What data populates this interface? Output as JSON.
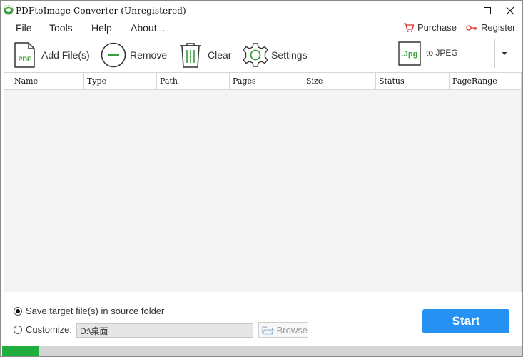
{
  "window": {
    "title": "PDFtoImage Converter (Unregistered)",
    "controls": [
      "minimize",
      "maximize",
      "close"
    ]
  },
  "menu": {
    "items": [
      {
        "label": "File"
      },
      {
        "label": "Tools"
      },
      {
        "label": "Help"
      },
      {
        "label": "About..."
      }
    ],
    "purchase_label": "Purchase",
    "register_label": "Register"
  },
  "toolbar": {
    "add_files_label": "Add File(s)",
    "add_files_icon_text": "PDF",
    "remove_label": "Remove",
    "clear_label": "Clear",
    "settings_label": "Settings",
    "format_icon_text": ".Jpg",
    "format_label": "to JPEG"
  },
  "table": {
    "columns": [
      "Name",
      "Type",
      "Path",
      "Pages",
      "Size",
      "Status",
      "PageRange"
    ],
    "rows": []
  },
  "output": {
    "option_source_label": "Save target file(s) in source folder",
    "option_source_selected": true,
    "option_custom_label": "Customize:",
    "option_custom_selected": false,
    "custom_path_value": "D:\\桌面",
    "browse_label": "Browse"
  },
  "start_label": "Start",
  "progress": {
    "fraction": 0.07
  },
  "colors": {
    "accent": "#2693f4",
    "progress": "#1fae3c",
    "icon_green": "#3a9d3a",
    "link_red": "#d9302c"
  }
}
